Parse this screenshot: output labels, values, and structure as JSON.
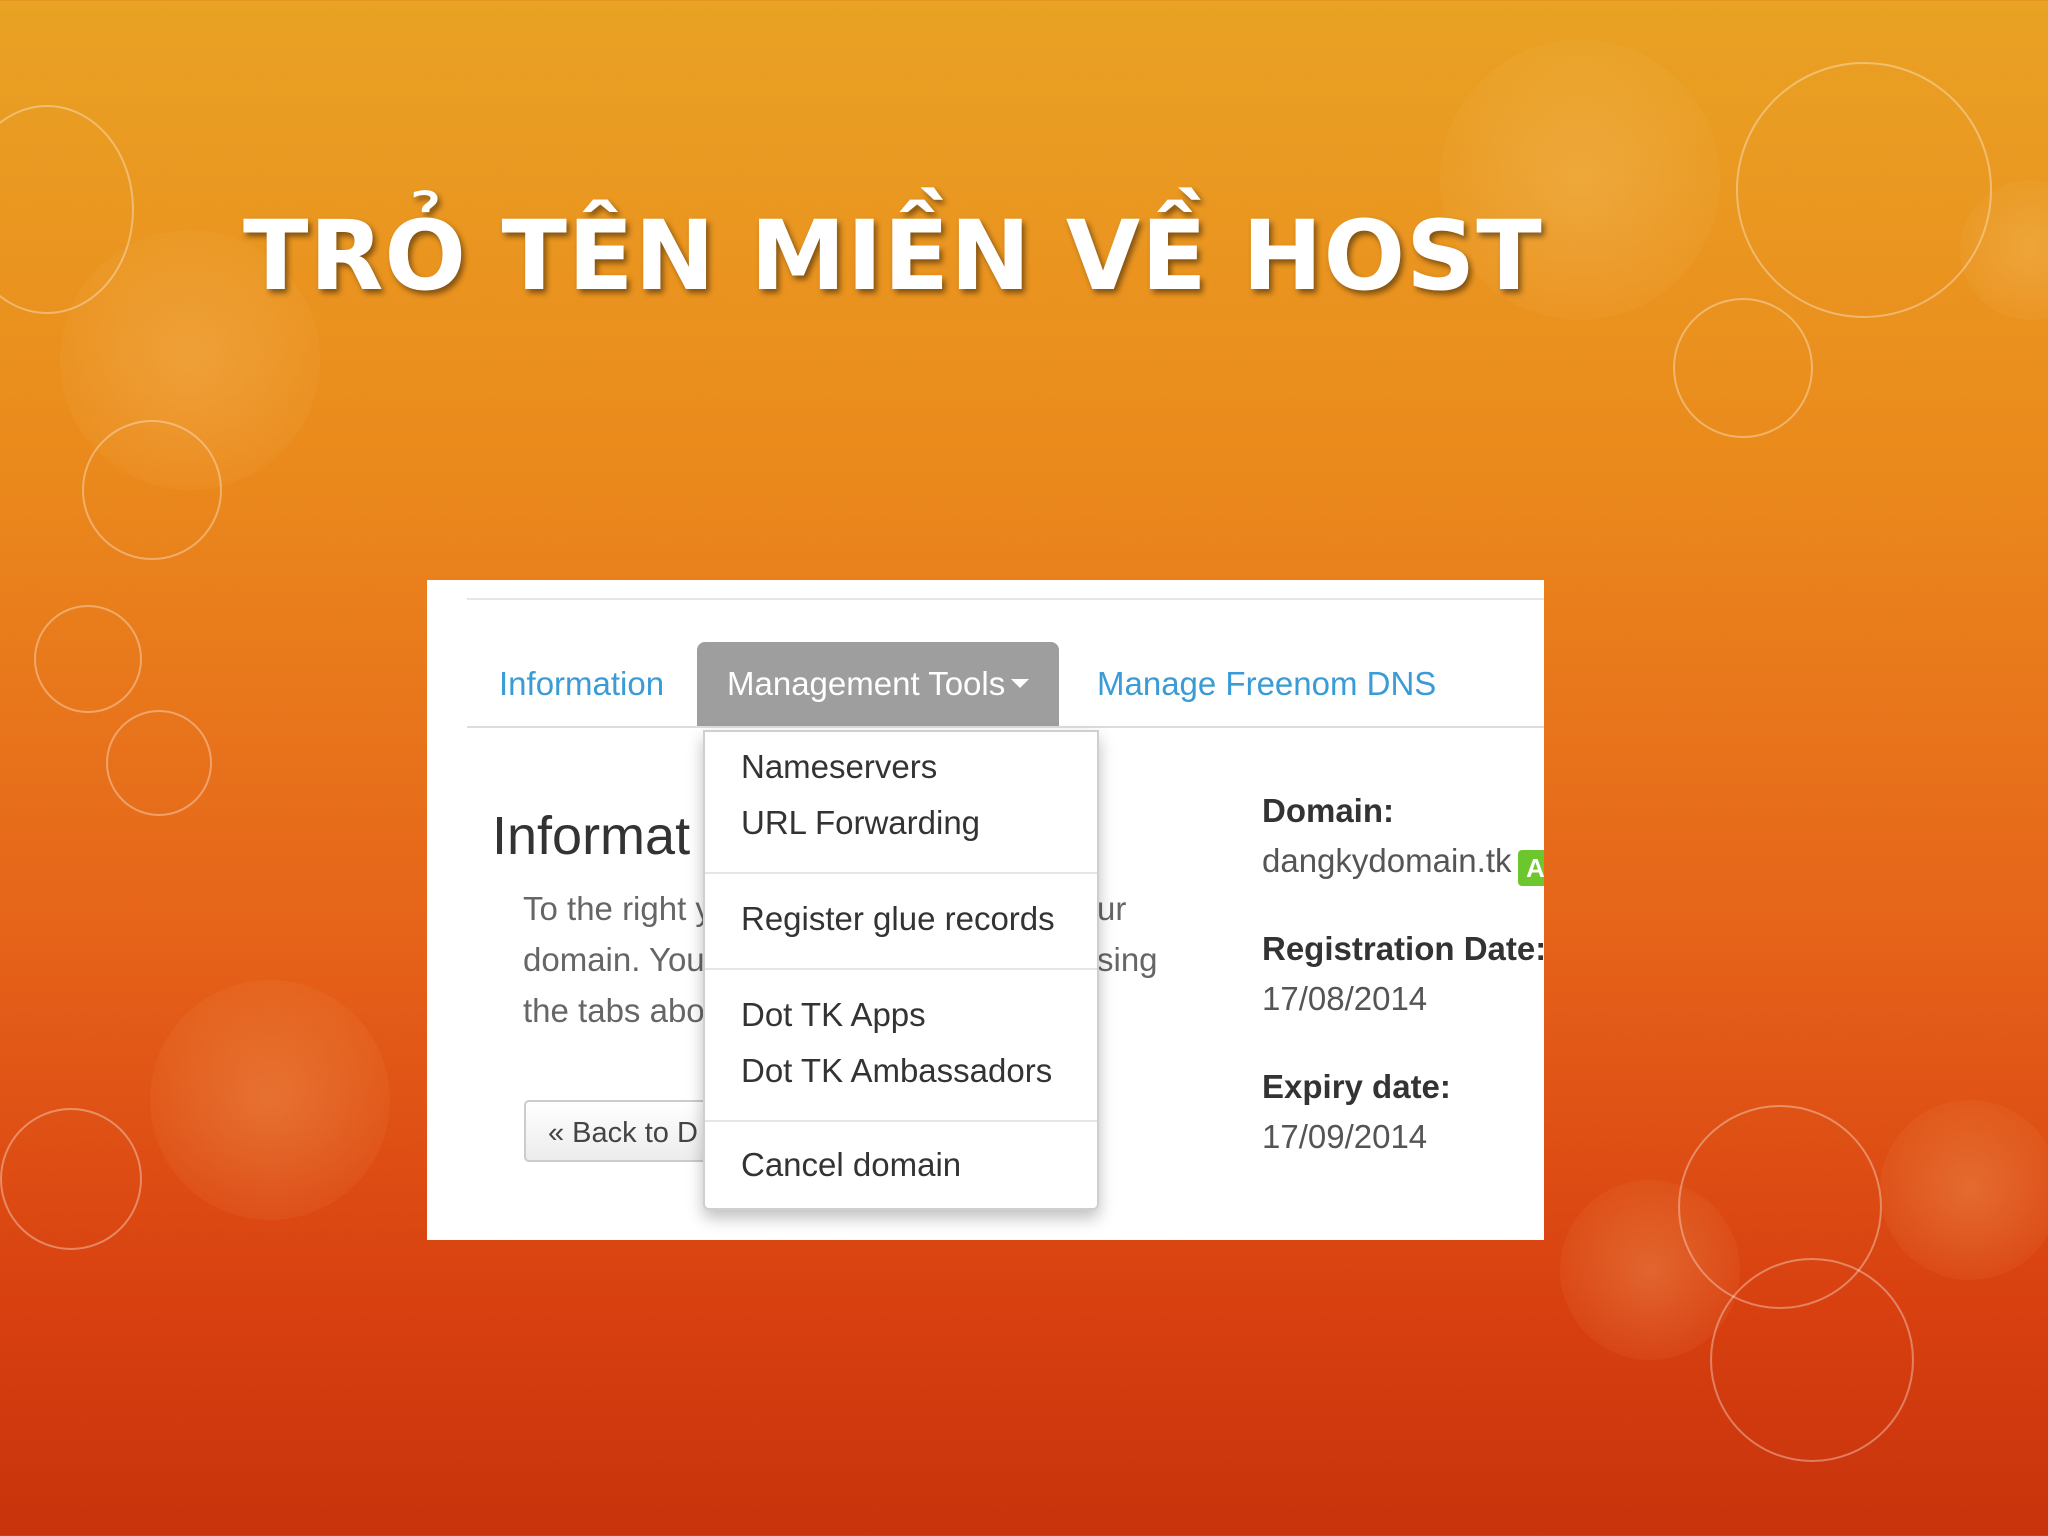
{
  "slide": {
    "title": "TRỎ TÊN MIỀN VỀ HOST"
  },
  "tabs": [
    {
      "label": "Information"
    },
    {
      "label": "Management Tools"
    },
    {
      "label": "Manage Freenom DNS"
    }
  ],
  "main": {
    "heading": "Informat",
    "body_lines": [
      "To the right y",
      "domain. You",
      "the tabs abo"
    ],
    "body_tail": [
      "ur",
      "sing"
    ],
    "back_button": "« Back to D"
  },
  "dropdown": {
    "items": [
      "Nameservers",
      "URL Forwarding",
      "Register glue records",
      "Dot TK Apps",
      "Dot TK Ambassadors",
      "Cancel domain"
    ]
  },
  "sidebar": {
    "domain_label": "Domain:",
    "domain_value": "dangkydomain.tk",
    "status_badge": "A",
    "registration_label": "Registration Date:",
    "registration_value": "17/08/2014",
    "expiry_label": "Expiry date:",
    "expiry_value": "17/09/2014"
  },
  "colors": {
    "link": "#3a9bd6",
    "active_tab": "#9e9e9e",
    "badge": "#6cc72f"
  }
}
